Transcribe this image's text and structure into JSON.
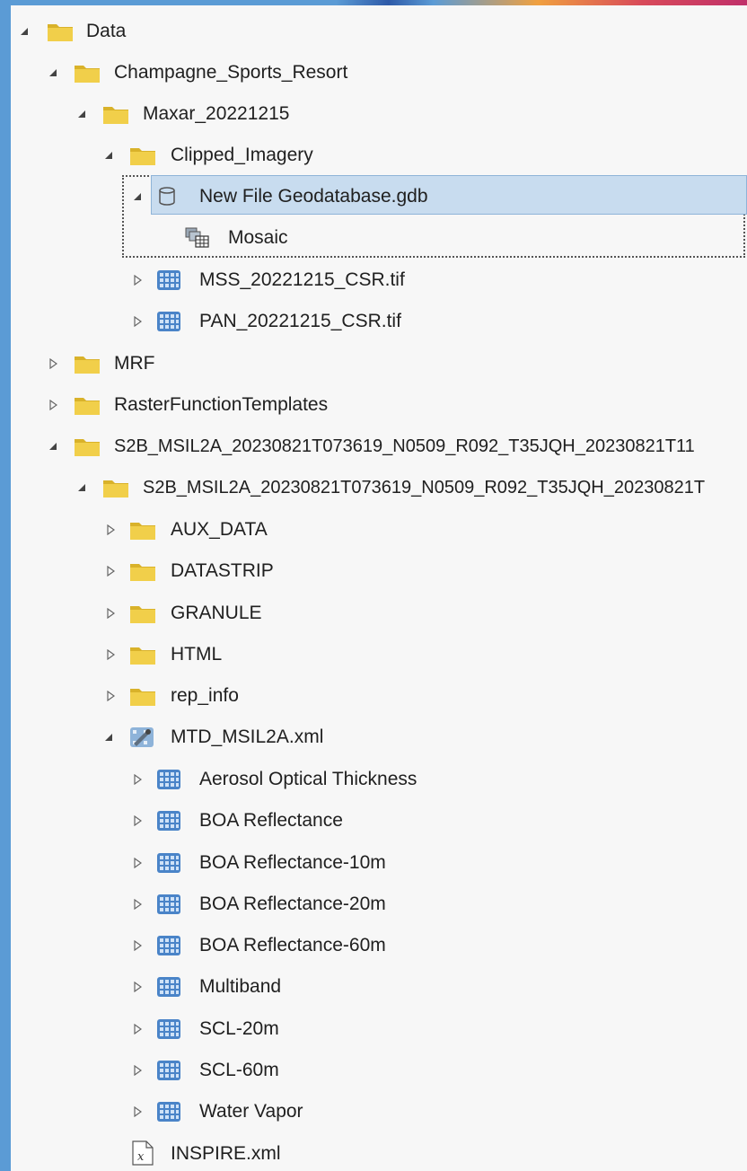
{
  "tree": {
    "data": "Data",
    "champagne": "Champagne_Sports_Resort",
    "maxar": "Maxar_20221215",
    "clipped": "Clipped_Imagery",
    "gdb": "New File Geodatabase.gdb",
    "mosaic": "Mosaic",
    "mss": "MSS_20221215_CSR.tif",
    "pan": "PAN_20221215_CSR.tif",
    "mrf": "MRF",
    "rft": "RasterFunctionTemplates",
    "s2b_outer": "S2B_MSIL2A_20230821T073619_N0509_R092_T35JQH_20230821T11",
    "s2b_inner": "S2B_MSIL2A_20230821T073619_N0509_R092_T35JQH_20230821T",
    "aux": "AUX_DATA",
    "datastrip": "DATASTRIP",
    "granule": "GRANULE",
    "html": "HTML",
    "rep": "rep_info",
    "mtd": "MTD_MSIL2A.xml",
    "aot": "Aerosol Optical Thickness",
    "boa": "BOA Reflectance",
    "boa10": "BOA Reflectance-10m",
    "boa20": "BOA Reflectance-20m",
    "boa60": "BOA Reflectance-60m",
    "multiband": "Multiband",
    "scl20": "SCL-20m",
    "scl60": "SCL-60m",
    "wv": "Water Vapor",
    "inspire": "INSPIRE.xml"
  },
  "icons": {
    "folder": "folder-icon",
    "geodatabase": "geodatabase-icon",
    "mosaic": "mosaic-dataset-icon",
    "raster": "raster-icon",
    "metadata": "raster-product-icon",
    "xml": "xml-file-icon"
  },
  "colors": {
    "folder": "#e8c43a",
    "raster": "#4a84c8",
    "selection": "#c8dcef"
  }
}
